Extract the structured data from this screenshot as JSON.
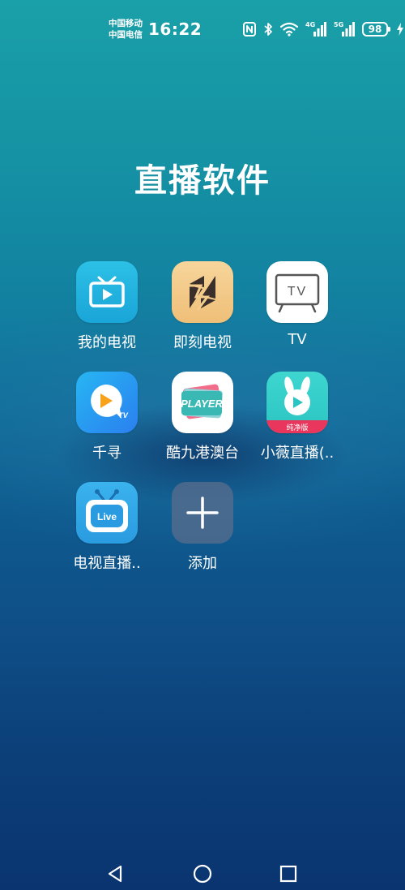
{
  "status_bar": {
    "carrier_1": "中国移动",
    "carrier_2": "中国电信",
    "time": "16:22",
    "network_1": "4G",
    "network_2": "5G",
    "battery": "98",
    "icons": [
      "nfc-icon",
      "bluetooth-icon",
      "wifi-icon",
      "signal-4g-icon",
      "signal-5g-icon",
      "battery-icon",
      "charging-icon"
    ]
  },
  "folder": {
    "title": "直播软件",
    "apps": [
      {
        "label": "我的电视",
        "icon": "tv-play-icon",
        "color": "#21b3dd"
      },
      {
        "label": "即刻电视",
        "icon": "lightning-icon",
        "color": "#f4cc8c"
      },
      {
        "label": "TV",
        "icon": "tv-monitor-icon",
        "color": "#ffffff"
      },
      {
        "label": "千寻",
        "icon": "play-bubble-icon",
        "color": "#2a8ff0"
      },
      {
        "label": "酷九港澳台",
        "icon": "player-cards-icon",
        "color": "#ffffff"
      },
      {
        "label": "小薇直播(..",
        "icon": "rabbit-play-icon",
        "color": "#34d0c8"
      },
      {
        "label": "电视直播..",
        "icon": "live-tv-icon",
        "color": "#2ea6e6"
      },
      {
        "label": "添加",
        "icon": "plus-icon",
        "color": "#4e6a8a"
      }
    ],
    "icon_texts": {
      "tv": "TV",
      "player": "PLAYER",
      "qianxun_tv": "TV",
      "pure": "纯净版",
      "live": "Live"
    }
  },
  "nav_bar": {
    "items": [
      "back-icon",
      "home-icon",
      "recents-icon"
    ]
  }
}
